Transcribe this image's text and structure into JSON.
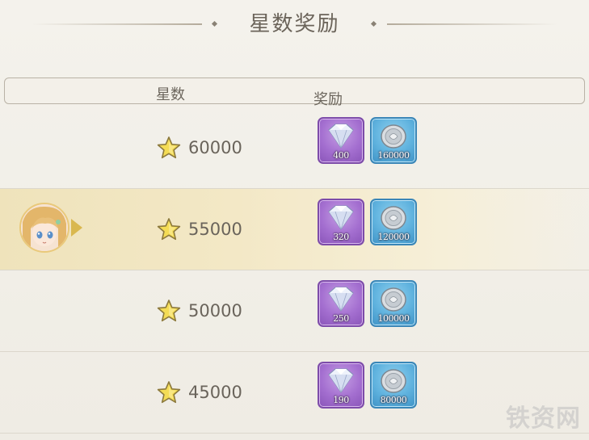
{
  "title": "星数奖励",
  "header": {
    "stars_label": "星数",
    "reward_label": "奖励"
  },
  "rows": [
    {
      "stars": "60000",
      "rewards": [
        {
          "icon": "diamond-icon",
          "qty": "400"
        },
        {
          "icon": "silver-coin-icon",
          "qty": "160000"
        }
      ],
      "current": false
    },
    {
      "stars": "55000",
      "rewards": [
        {
          "icon": "diamond-icon",
          "qty": "320"
        },
        {
          "icon": "silver-coin-icon",
          "qty": "120000"
        }
      ],
      "current": true
    },
    {
      "stars": "50000",
      "rewards": [
        {
          "icon": "diamond-icon",
          "qty": "250"
        },
        {
          "icon": "silver-coin-icon",
          "qty": "100000"
        }
      ],
      "current": false
    },
    {
      "stars": "45000",
      "rewards": [
        {
          "icon": "diamond-icon",
          "qty": "190"
        },
        {
          "icon": "silver-coin-icon",
          "qty": "80000"
        }
      ],
      "current": false
    }
  ],
  "watermark": "铁资网",
  "colors": {
    "gem_frame": "#a46fd0",
    "coin_frame": "#5fb2de",
    "highlight": "#f3e8c6",
    "star": "#f2d64b"
  }
}
